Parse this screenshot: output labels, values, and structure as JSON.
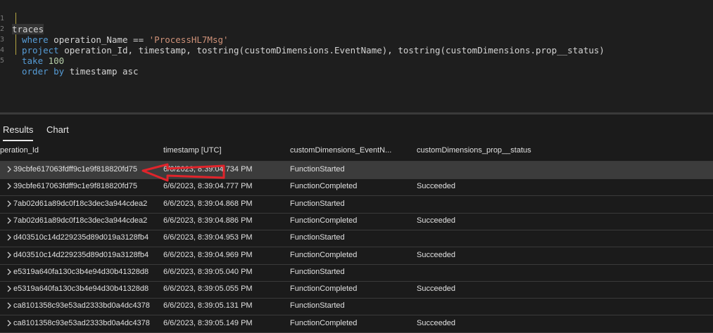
{
  "query": {
    "line_numbers": [
      "1",
      "2",
      "3",
      "4",
      "5"
    ],
    "line1": "traces",
    "line2": {
      "kw": "where",
      "mid": " operation_Name == ",
      "str": "'ProcessHL7Msg'"
    },
    "line3": {
      "kw": "project",
      "rest": " operation_Id, timestamp, tostring(customDimensions.EventName), tostring(customDimensions.prop__status)"
    },
    "line4": {
      "kw": "take",
      "num": " 100"
    },
    "line5": {
      "kw": "order by",
      "rest": " timestamp asc"
    }
  },
  "tabs": {
    "results": "Results",
    "chart": "Chart"
  },
  "columns": [
    "peration_Id",
    "timestamp [UTC]",
    "customDimensions_EventN...",
    "customDimensions_prop__status"
  ],
  "rows": [
    {
      "id": "39cbfe617063fdff9c1e9f818820fd75",
      "ts": "6/6/2023, 8:39:04.734 PM",
      "event": "FunctionStarted",
      "status": ""
    },
    {
      "id": "39cbfe617063fdff9c1e9f818820fd75",
      "ts": "6/6/2023, 8:39:04.777 PM",
      "event": "FunctionCompleted",
      "status": "Succeeded"
    },
    {
      "id": "7ab02d61a89dc0f18c3dec3a944cdea2",
      "ts": "6/6/2023, 8:39:04.868 PM",
      "event": "FunctionStarted",
      "status": ""
    },
    {
      "id": "7ab02d61a89dc0f18c3dec3a944cdea2",
      "ts": "6/6/2023, 8:39:04.886 PM",
      "event": "FunctionCompleted",
      "status": "Succeeded"
    },
    {
      "id": "d403510c14d229235d89d019a3128fb4",
      "ts": "6/6/2023, 8:39:04.953 PM",
      "event": "FunctionStarted",
      "status": ""
    },
    {
      "id": "d403510c14d229235d89d019a3128fb4",
      "ts": "6/6/2023, 8:39:04.969 PM",
      "event": "FunctionCompleted",
      "status": "Succeeded"
    },
    {
      "id": "e5319a640fa130c3b4e94d30b41328d8",
      "ts": "6/6/2023, 8:39:05.040 PM",
      "event": "FunctionStarted",
      "status": ""
    },
    {
      "id": "e5319a640fa130c3b4e94d30b41328d8",
      "ts": "6/6/2023, 8:39:05.055 PM",
      "event": "FunctionCompleted",
      "status": "Succeeded"
    },
    {
      "id": "ca8101358c93e53ad2333bd0a4dc4378",
      "ts": "6/6/2023, 8:39:05.131 PM",
      "event": "FunctionStarted",
      "status": ""
    },
    {
      "id": "ca8101358c93e53ad2333bd0a4dc4378",
      "ts": "6/6/2023, 8:39:05.149 PM",
      "event": "FunctionCompleted",
      "status": "Succeeded"
    }
  ],
  "colors": {
    "annotation_arrow": "#e0242b"
  }
}
